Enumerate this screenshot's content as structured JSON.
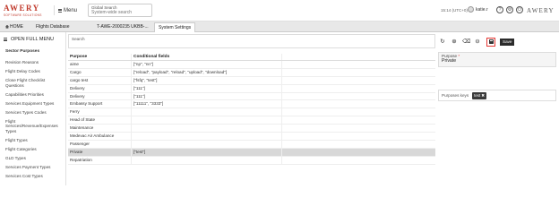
{
  "header": {
    "logo_word": "AWERY",
    "logo_tagline": "SOFTWARE SOLUTIONS",
    "menu_label": "Menu",
    "search_label": "Global Search",
    "search_placeholder": "System-wide search",
    "clock": "15:14 (UTC+0)",
    "username": "katie.r",
    "logo_right": "AWERY"
  },
  "tabs": {
    "home": "HOME",
    "flights": "Flights Database",
    "doc": "T-AWE-2000235 UKBB-...",
    "system": "System Settings"
  },
  "sidebar": {
    "open_menu": "OPEN FULL MENU",
    "title": "Sector Purposes",
    "items": [
      "Revision Reasons",
      "Flight Delay Codes",
      "Close Flight Checklist Questions",
      "Capabilities Priorities",
      "Services Equipment Types",
      "Services Types Codes",
      "Flight Services/Revenue/Expenses Types",
      "Flight Types",
      "Flight Categories",
      "GLD Types",
      "Services Payment Types",
      "Services Cost Types"
    ]
  },
  "main": {
    "search_label": "Search",
    "columns": [
      "Purpose",
      "Conditional fields"
    ],
    "rows": [
      {
        "purpose": "aime",
        "fields": "[\"np\", \"nn\"]"
      },
      {
        "purpose": "Cargo",
        "fields": "[\"reload\", \"payload\", \"reload\", \"upload\", \"download\"]"
      },
      {
        "purpose": "cargo test",
        "fields": "[\"fsfq\", \"test\"]"
      },
      {
        "purpose": "Delivery",
        "fields": "[\"111\"]"
      },
      {
        "purpose": "Delivery",
        "fields": "[\"111\"]"
      },
      {
        "purpose": "Embassy Support",
        "fields": "[\"11111\", \"3333\"]"
      },
      {
        "purpose": "Ferry",
        "fields": ""
      },
      {
        "purpose": "Head of State",
        "fields": ""
      },
      {
        "purpose": "Maintenance",
        "fields": ""
      },
      {
        "purpose": "Medevac Air Ambulance",
        "fields": ""
      },
      {
        "purpose": "Passenger",
        "fields": ""
      },
      {
        "purpose": "Private",
        "fields": "[\"test\"]"
      },
      {
        "purpose": "Repatriation",
        "fields": ""
      }
    ]
  },
  "panel": {
    "save_label": "Save",
    "purpose_label": "Purpose",
    "required_mark": "*",
    "purpose_value": "Private",
    "keys_label": "Purposes keys",
    "key_chip": "test"
  },
  "colors": {
    "brand": "#c0392b",
    "highlight_border": "#e53935",
    "selected_row": "#d8d8d8"
  },
  "icons": [
    "hamburger-icon",
    "user-icon",
    "help-icon",
    "gear-icon",
    "power-icon",
    "refresh-icon",
    "add-icon",
    "eraser-icon",
    "remove-icon",
    "save-icon",
    "home-icon",
    "close-icon"
  ]
}
